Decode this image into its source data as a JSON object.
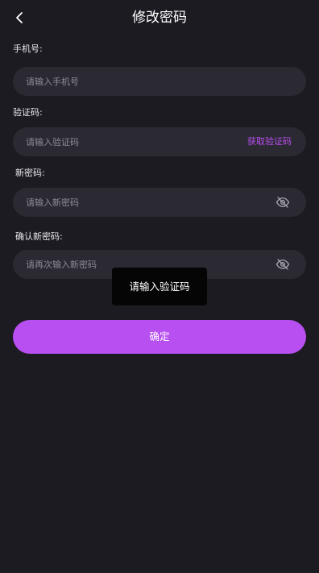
{
  "header": {
    "title": "修改密码",
    "back_icon": "chevron-left-icon"
  },
  "form": {
    "phone": {
      "label": "手机号:",
      "placeholder": "请输入手机号",
      "value": ""
    },
    "code": {
      "label": "验证码:",
      "placeholder": "请输入验证码",
      "value": "",
      "get_code_label": "获取验证码"
    },
    "new_password": {
      "label": "新密码:",
      "placeholder": "请输入新密码",
      "value": "",
      "visibility_icon": "eye-off-icon"
    },
    "confirm_password": {
      "label": "确认新密码:",
      "placeholder": "请再次输入新密码",
      "value": "",
      "visibility_icon": "eye-off-icon"
    },
    "submit_label": "确定"
  },
  "toast": {
    "message": "请输入验证码"
  },
  "colors": {
    "background": "#1d1b22",
    "input_background": "#2b2932",
    "accent": "#b84ff0",
    "placeholder": "#8e8b96",
    "toast_background": "#050505"
  }
}
